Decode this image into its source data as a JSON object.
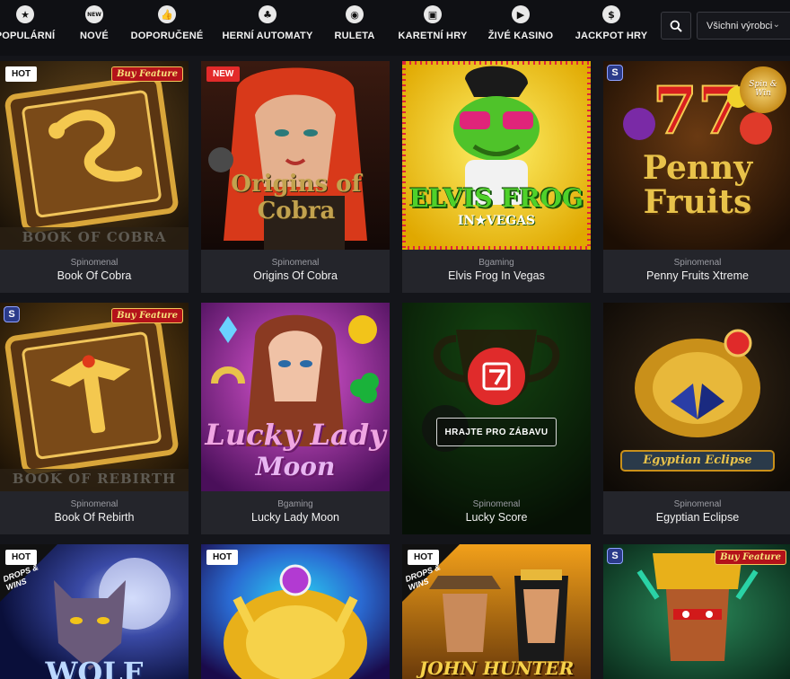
{
  "nav": {
    "items": [
      {
        "label": "POPULÁRNÍ",
        "icon": "star-icon"
      },
      {
        "label": "NOVÉ",
        "icon": "new-icon"
      },
      {
        "label": "DOPORUČENÉ",
        "icon": "thumbs-up-icon"
      },
      {
        "label": "HERNÍ AUTOMATY",
        "icon": "slot-cherry-icon"
      },
      {
        "label": "RULETA",
        "icon": "roulette-icon"
      },
      {
        "label": "KARETNÍ HRY",
        "icon": "card-icon"
      },
      {
        "label": "ŽIVÉ KASINO",
        "icon": "play-icon"
      },
      {
        "label": "JACKPOT HRY",
        "icon": "money-bag-icon"
      }
    ],
    "search_icon": "search-icon",
    "provider_select": "Všichni výrobci"
  },
  "games": [
    {
      "provider": "Spinomenal",
      "name": "Book Of Cobra",
      "badge": "HOT",
      "buy_feature": "Buy Feature",
      "art_title": "BOOK OF COBRA"
    },
    {
      "provider": "Spinomenal",
      "name": "Origins Of Cobra",
      "badge": "NEW",
      "art_title": "Origins of Cobra"
    },
    {
      "provider": "Bgaming",
      "name": "Elvis Frog In Vegas",
      "art_title": "ELVIS FROG",
      "art_subtitle": "IN★VEGAS"
    },
    {
      "provider": "Spinomenal",
      "name": "Penny Fruits Xtreme",
      "corner": "S",
      "spin_label": "Spin & Win",
      "art_title": "Penny Fruits"
    },
    {
      "provider": "Spinomenal",
      "name": "Book Of Rebirth",
      "corner": "S",
      "buy_feature": "Buy Feature",
      "art_title": "BOOK OF REBIRTH"
    },
    {
      "provider": "Bgaming",
      "name": "Lucky Lady Moon",
      "art_title": "Lucky Lady",
      "art_subtitle": "Moon"
    },
    {
      "provider": "Spinomenal",
      "name": "Lucky Score",
      "play_button": "HRAJTE PRO ZÁBAVU"
    },
    {
      "provider": "Spinomenal",
      "name": "Egyptian Eclipse",
      "art_title": "Egyptian Eclipse"
    },
    {
      "badge": "HOT",
      "drops_wins": "DROPS & WINS",
      "art_title": "WOLF"
    },
    {
      "badge": "HOT"
    },
    {
      "badge": "HOT",
      "drops_wins": "DROPS & WINS",
      "art_title": "JOHN HUNTER"
    },
    {
      "corner": "S",
      "buy_feature": "Buy Feature"
    }
  ],
  "colors": {
    "background": "#14151a",
    "card": "#24252b",
    "accent_red": "#e02b2b",
    "text_muted": "#9a9ba2"
  }
}
